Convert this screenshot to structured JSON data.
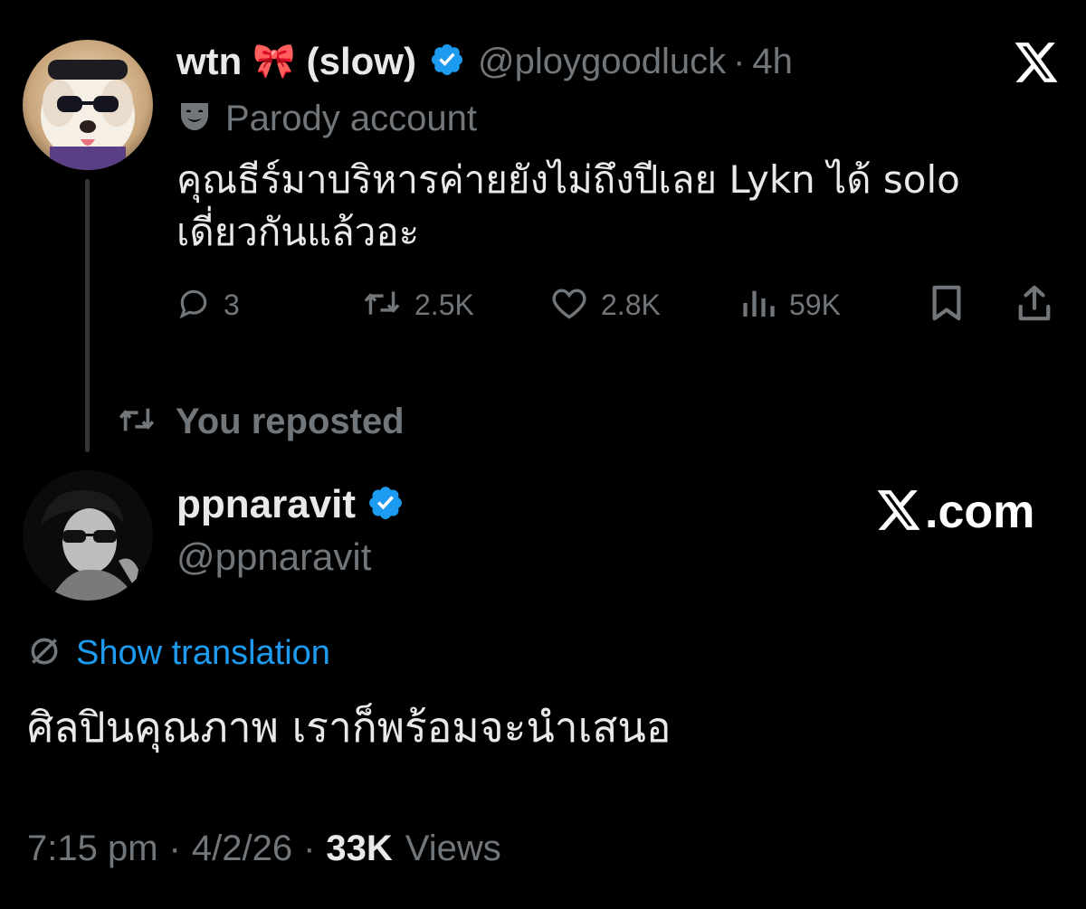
{
  "quoted_post": {
    "display_name": "wtn",
    "bow_emoji": "🎀",
    "display_name_suffix": "(slow)",
    "handle": "@ploygoodluck",
    "separator": "·",
    "time": "4h",
    "parody_label": "Parody account",
    "text": "คุณธีร์มาบริหารค่ายยังไม่ถึงปีเลย Lykn ได้ solo เดี่ยวกันแล้วอะ",
    "actions": {
      "replies": "3",
      "reposts": "2.5K",
      "likes": "2.8K",
      "views": "59K"
    }
  },
  "repost_label": "You reposted",
  "main_post": {
    "display_name": "ppnaravit",
    "handle": "@ppnaravit",
    "translate_label": "Show translation",
    "text": "ศิลปินคุณภาพ เราก็พร้อมจะนำเสนอ",
    "time": "7:15 pm",
    "date": "4/2/26",
    "separator": "·",
    "views_count": "33K",
    "views_label": "Views"
  },
  "watermark": {
    "domain": ".com"
  },
  "colors": {
    "background": "#000000",
    "text": "#e7e9ea",
    "muted": "#71767b",
    "link": "#1d9bf0",
    "verified": "#1d9bf0"
  },
  "icons": {
    "platform_logo": "x-logo-icon",
    "verified": "verified-badge-icon",
    "parody": "theater-mask-icon",
    "reply": "reply-icon",
    "repost": "repost-icon",
    "like": "heart-icon",
    "views": "views-icon",
    "bookmark": "bookmark-icon",
    "share": "share-icon",
    "translate": "globe-icon"
  }
}
